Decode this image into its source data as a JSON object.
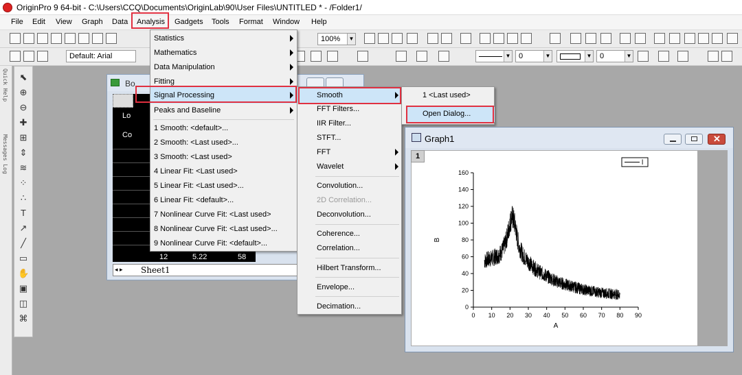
{
  "window": {
    "title": "OriginPro 9 64-bit - C:\\Users\\CCQ\\Documents\\OriginLab\\90\\User Files\\UNTITLED * - /Folder1/"
  },
  "menubar": {
    "items": [
      "File",
      "Edit",
      "View",
      "Graph",
      "Data",
      "Analysis",
      "Gadgets",
      "Tools",
      "Format",
      "Window",
      "Help"
    ]
  },
  "toolbar": {
    "zoom": "100%",
    "font": "Default: Arial",
    "line_width": "0",
    "fill_width": "0"
  },
  "side_labels": {
    "quick_help": "Quick Help",
    "messages_log": "Messages Log"
  },
  "analysis_menu": [
    {
      "label": "Statistics",
      "sub": true
    },
    {
      "label": "Mathematics",
      "sub": true
    },
    {
      "label": "Data Manipulation",
      "sub": true
    },
    {
      "label": "Fitting",
      "sub": true
    },
    {
      "label": "Signal Processing",
      "sub": true
    },
    {
      "label": "Peaks and Baseline",
      "sub": true
    },
    {
      "label": "1 Smooth: <default>..."
    },
    {
      "label": "2 Smooth: <Last used>..."
    },
    {
      "label": "3 Smooth: <Last used>"
    },
    {
      "label": "4 Linear Fit: <Last used>"
    },
    {
      "label": "5 Linear Fit: <Last used>..."
    },
    {
      "label": "6 Linear Fit: <default>..."
    },
    {
      "label": "7 Nonlinear Curve Fit: <Last used>"
    },
    {
      "label": "8 Nonlinear Curve Fit: <Last used>..."
    },
    {
      "label": "9 Nonlinear Curve Fit: <default>..."
    }
  ],
  "signal_menu": [
    {
      "label": "Smooth",
      "sub": true
    },
    {
      "label": "FFT Filters..."
    },
    {
      "label": "IIR Filter..."
    },
    {
      "label": "STFT..."
    },
    {
      "label": "FFT",
      "sub": true
    },
    {
      "label": "Wavelet",
      "sub": true
    },
    {
      "label": "Convolution..."
    },
    {
      "label": "2D Correlation...",
      "disabled": true
    },
    {
      "label": "Deconvolution..."
    },
    {
      "label": "Coherence..."
    },
    {
      "label": "Correlation..."
    },
    {
      "label": "Hilbert Transform..."
    },
    {
      "label": "Envelope..."
    },
    {
      "label": "Decimation..."
    }
  ],
  "smooth_menu": [
    {
      "label": "1 <Last used>"
    },
    {
      "label": "Open Dialog..."
    }
  ],
  "workbook": {
    "title": "Bo",
    "row_labels": [
      "Lo",
      "Co"
    ],
    "last_row": [
      "12",
      "5.22",
      "58"
    ],
    "sheet_tab": "Sheet1"
  },
  "graph": {
    "title": "Graph1",
    "layer": "1",
    "legend_label": "l"
  },
  "chart_data": {
    "type": "line",
    "title": "",
    "xlabel": "A",
    "ylabel": "B",
    "xlim": [
      0,
      90
    ],
    "ylim": [
      0,
      160
    ],
    "xticks": [
      0,
      10,
      20,
      30,
      40,
      50,
      60,
      70,
      80,
      90
    ],
    "yticks": [
      0,
      20,
      40,
      60,
      80,
      100,
      120,
      140,
      160
    ],
    "series": [
      {
        "x": [
          6,
          8,
          10,
          12,
          14,
          16,
          18,
          19,
          20,
          21,
          22,
          23,
          24,
          25,
          27,
          30,
          33,
          36,
          40,
          45,
          50,
          55,
          60,
          65,
          70,
          75,
          80
        ],
        "y": [
          55,
          57,
          58,
          60,
          62,
          68,
          80,
          90,
          100,
          108,
          104,
          95,
          82,
          72,
          62,
          54,
          47,
          42,
          37,
          31,
          27,
          24,
          21,
          19,
          17,
          16,
          15
        ]
      }
    ],
    "grid": false,
    "color": "#000000"
  }
}
